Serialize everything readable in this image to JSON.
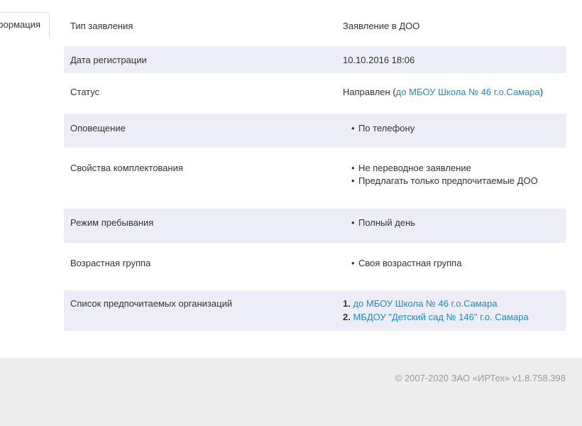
{
  "tab": {
    "label": "Информация"
  },
  "rows": [
    {
      "label": "Тип заявления",
      "value": "Заявление в ДОО"
    },
    {
      "label": "Дата регистрации",
      "value": "10.10.2016 18:06"
    },
    {
      "label": "Статус",
      "value_prefix": "Направлен (",
      "value_link": "до МБОУ Школа № 46 г.о.Самара",
      "value_suffix": ")"
    },
    {
      "label": "Оповещение",
      "items": [
        "По телефону"
      ]
    },
    {
      "label": "Свойства комплектования",
      "items": [
        "Не переводное заявление",
        "Предлагать только предпочитаемые ДОО"
      ]
    },
    {
      "label": "Режим пребывания",
      "items": [
        "Полный день"
      ]
    },
    {
      "label": "Возрастная группа",
      "items": [
        "Своя возрастная группа"
      ]
    },
    {
      "label": "Список предпочитаемых организаций",
      "orgs": [
        {
          "num": "1.",
          "name": "до МБОУ Школа № 46 г.о.Самара"
        },
        {
          "num": "2.",
          "name": "МБДОУ \"Детский сад № 146\" г.о. Самара"
        }
      ]
    }
  ],
  "footer": {
    "copyright": "© 2007-2020 ЗАО «ИРТех» v1.8.758.398"
  },
  "colors": {
    "link": "#1f89c8",
    "stripe": "#ededf8",
    "footer_bg": "#ededed"
  }
}
